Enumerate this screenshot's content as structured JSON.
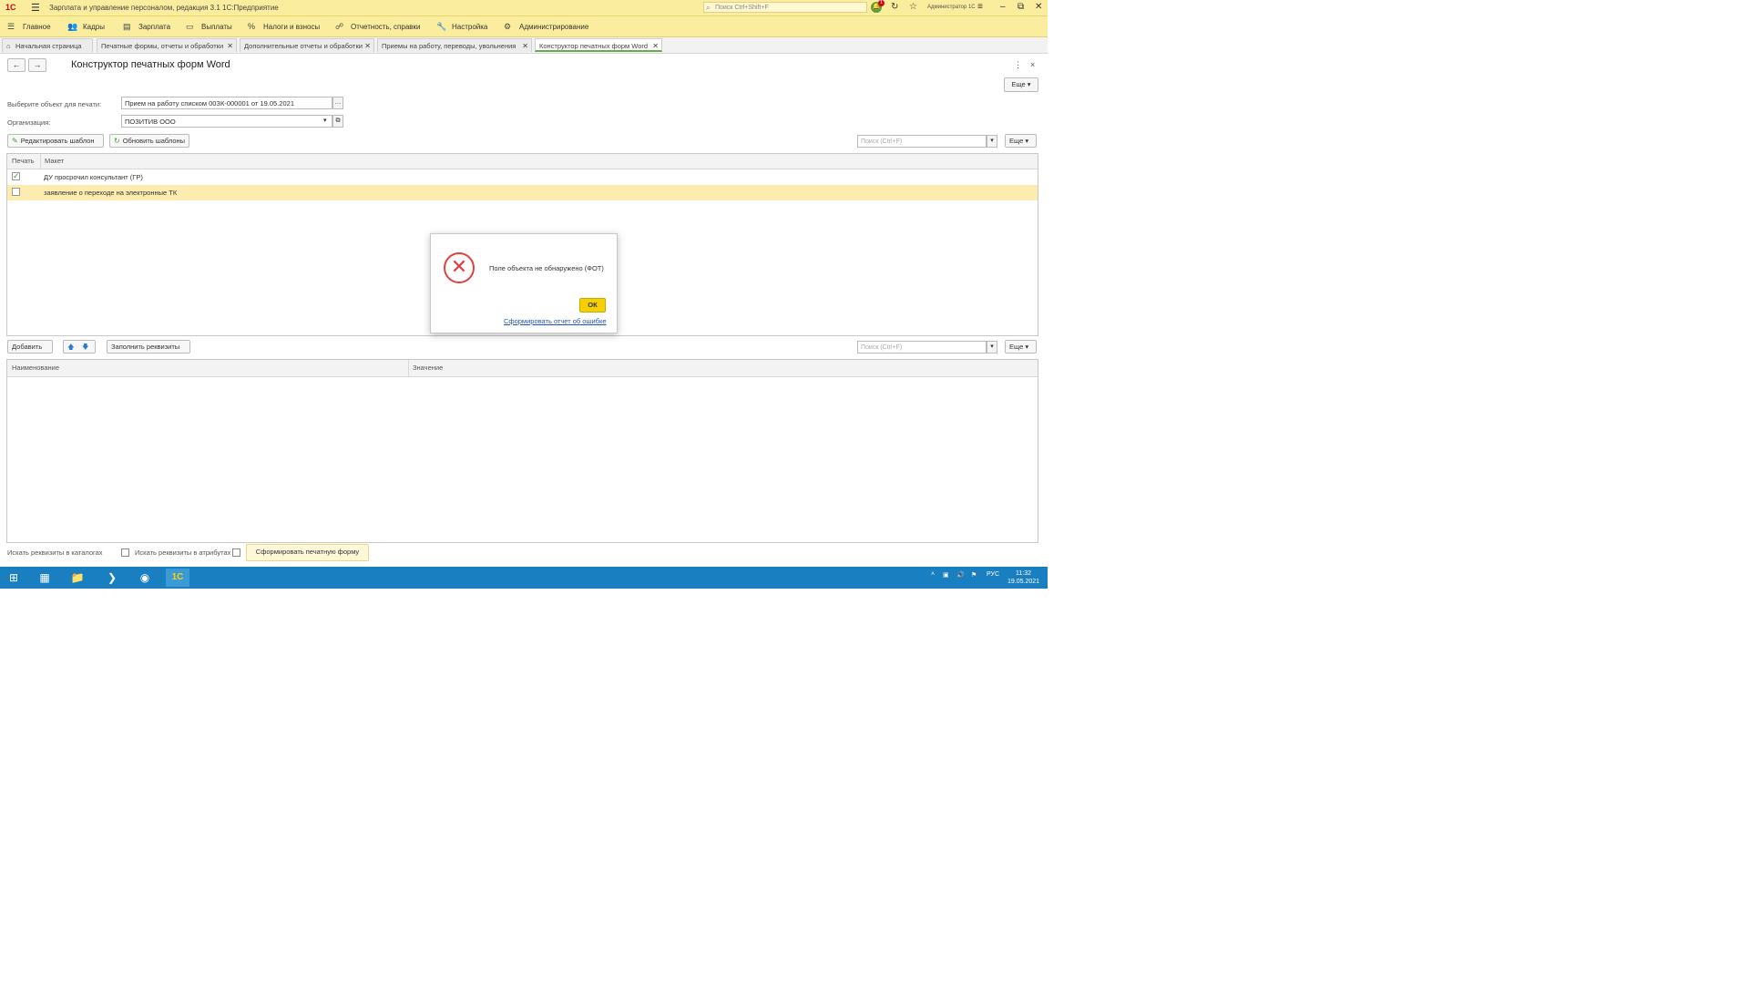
{
  "app": {
    "logo": "1С",
    "title": "Зарплата и управление персоналом, редакция 3.1 1С:Предприятие",
    "search_placeholder": "Поиск Ctrl+Shift+F",
    "notifications": "1",
    "user": "Администратор 1С"
  },
  "menu": [
    {
      "label": "Главное",
      "icon": "hamburger-icon"
    },
    {
      "label": "Кадры",
      "icon": "people-icon"
    },
    {
      "label": "Зарплата",
      "icon": "document-icon"
    },
    {
      "label": "Выплаты",
      "icon": "card-icon"
    },
    {
      "label": "Налоги и взносы",
      "icon": "percent-icon"
    },
    {
      "label": "Отчетность, справки",
      "icon": "report-icon"
    },
    {
      "label": "Настройка",
      "icon": "wrench-icon"
    },
    {
      "label": "Администрирование",
      "icon": "gear-icon"
    }
  ],
  "tabs": [
    {
      "label": "Начальная страница"
    },
    {
      "label": "Печатные формы, отчеты и обработки"
    },
    {
      "label": "Дополнительные отчеты и обработки"
    },
    {
      "label": "Приемы на работу, переводы, увольнения"
    },
    {
      "label": "Конструктор печатных форм Word"
    }
  ],
  "form": {
    "title": "Конструктор печатных форм Word",
    "more_label": "Еще",
    "object_label": "Выберите объект для печати:",
    "object_value": "Прием на работу списком 00ЗК-000001 от 19.05.2021",
    "org_label": "Организация:",
    "org_value": "ПОЗИТИВ ООО",
    "edit_layout_label": "Редактировать шаблон",
    "refresh_layout_label": "Обновить шаблоны",
    "search_placeholder": "Поиск (Ctrl+F)",
    "more_short": "Еще",
    "grid1": {
      "col_print": "Печать",
      "col_layout": "Макет",
      "rows": [
        {
          "checked": true,
          "label": "ДУ просрочил консультант (ГР)"
        },
        {
          "checked": false,
          "label": "заявление о переходе на электронные ТК"
        }
      ]
    },
    "add_label": "Добавить",
    "fill_details_label": "Заполнить реквизиты",
    "grid2": {
      "col_name": "Наименование",
      "col_value": "Значение"
    },
    "footer": {
      "search_in_catalog_label": "Искать реквизиты в каталогах",
      "search_in_attrs_label": "Искать реквизиты в атрибутах",
      "generate_label": "Сформировать печатную форму"
    }
  },
  "dialog": {
    "message": "Поле объекта не обнаружено (ФОТ)",
    "ok_label": "ОК",
    "link_label": "Сформировать отчет об ошибке"
  },
  "taskbar": {
    "lang": "РУС",
    "time": "11:32",
    "date": "19.05.2021"
  },
  "colors": {
    "accent_yellow": "#fbed9e",
    "ok_button": "#f5d000",
    "taskbar": "#1a7fc1",
    "active_tab_underline": "#6aaa4a",
    "error_red": "#e04040"
  }
}
